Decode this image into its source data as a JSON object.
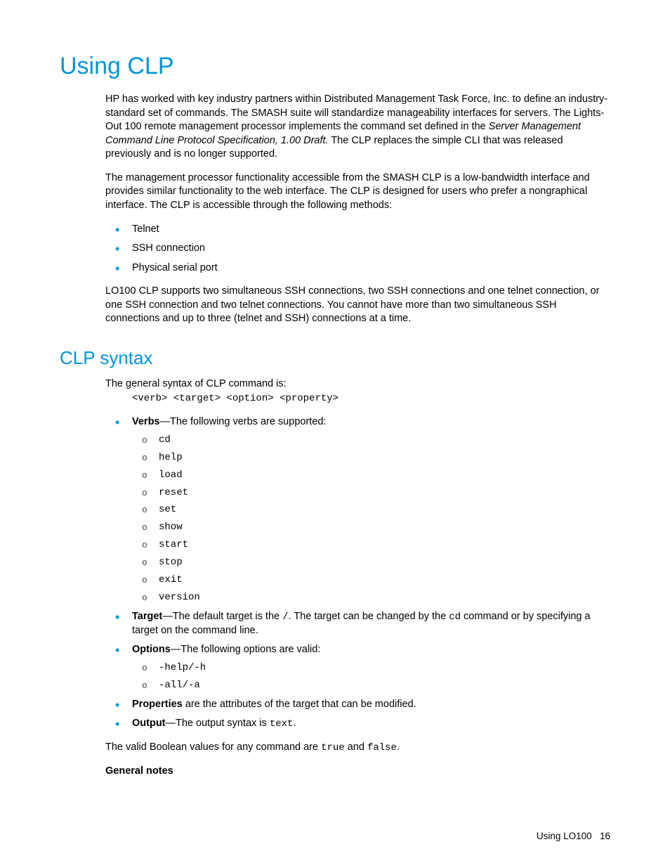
{
  "title": "Using CLP",
  "intro_p1_a": "HP has worked with key industry partners within Distributed Management Task Force, Inc. to define an industry-standard set of commands. The SMASH suite will standardize manageability interfaces for servers. The Lights-Out 100 remote management processor implements the command set defined in the ",
  "intro_p1_ital": "Server Management Command Line Protocol Specification, 1.00 Draft.",
  "intro_p1_b": " The CLP replaces the simple CLI that was released previously and is no longer supported.",
  "intro_p2": "The management processor functionality accessible from the SMASH CLP is a low-bandwidth interface and provides similar functionality to the web interface. The CLP is designed for users who prefer a nongraphical interface. The CLP is accessible through the following methods:",
  "methods": [
    "Telnet",
    "SSH connection",
    "Physical serial port"
  ],
  "intro_p3": "LO100 CLP supports two simultaneous SSH connections, two SSH connections and one telnet connection, or one SSH connection and two telnet connections. You cannot have more than two simultaneous SSH connections and up to three (telnet and SSH) connections at a time.",
  "section2_title": "CLP syntax",
  "syntax_intro": "The general syntax of CLP command is:",
  "syntax_line": "<verb> <target> <option> <property>",
  "verbs_label": "Verbs",
  "verbs_text": "—The following verbs are supported:",
  "verbs": [
    "cd",
    "help",
    "load",
    "reset",
    "set",
    "show",
    "start",
    "stop",
    "exit",
    "version"
  ],
  "target_label": "Target",
  "target_text_a": "—The default target is the ",
  "target_slash": "/",
  "target_text_b": ". The target can be changed by the ",
  "target_cd": "cd",
  "target_text_c": " command or by specifying a target on the command line.",
  "options_label": "Options",
  "options_text": "—The following options are valid:",
  "options": [
    "-help/-h",
    "-all/-a"
  ],
  "properties_label": "Properties",
  "properties_text": " are the attributes of the target that can be modified.",
  "output_label": "Output",
  "output_text_a": "—The output syntax is ",
  "output_code": "text",
  "output_text_b": ".",
  "bool_a": "The valid Boolean values for any command are ",
  "bool_true": "true",
  "bool_mid": " and ",
  "bool_false": "false",
  "bool_end": ".",
  "general_notes": "General notes",
  "footer_label": "Using LO100",
  "footer_page": "16"
}
